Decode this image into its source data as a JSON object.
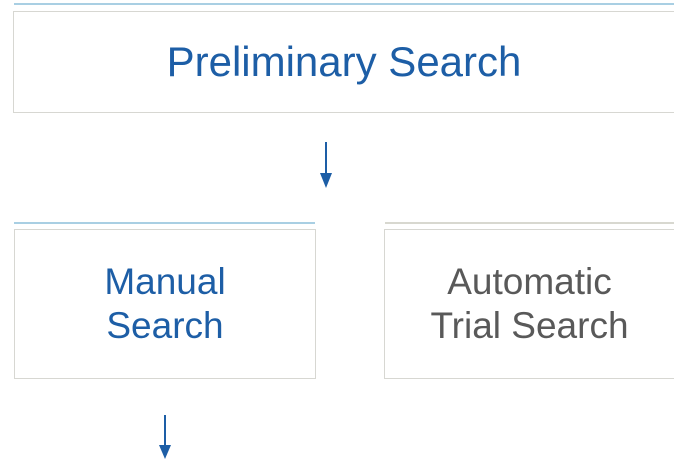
{
  "diagram": {
    "nodes": {
      "preliminary": {
        "label": "Preliminary Search"
      },
      "manual": {
        "line1": "Manual",
        "line2": "Search"
      },
      "automatic": {
        "line1": "Automatic",
        "line2": "Trial Search"
      }
    },
    "edges": [
      {
        "from": "preliminary",
        "to": "manual"
      },
      {
        "from": "manual",
        "to": "next"
      }
    ]
  },
  "colors": {
    "node_text_primary": "#1d5ea6",
    "node_text_secondary": "#595959",
    "border": "#d7d7d2",
    "accent_line": "#a9cfe3",
    "arrow": "#1d5ea6"
  }
}
